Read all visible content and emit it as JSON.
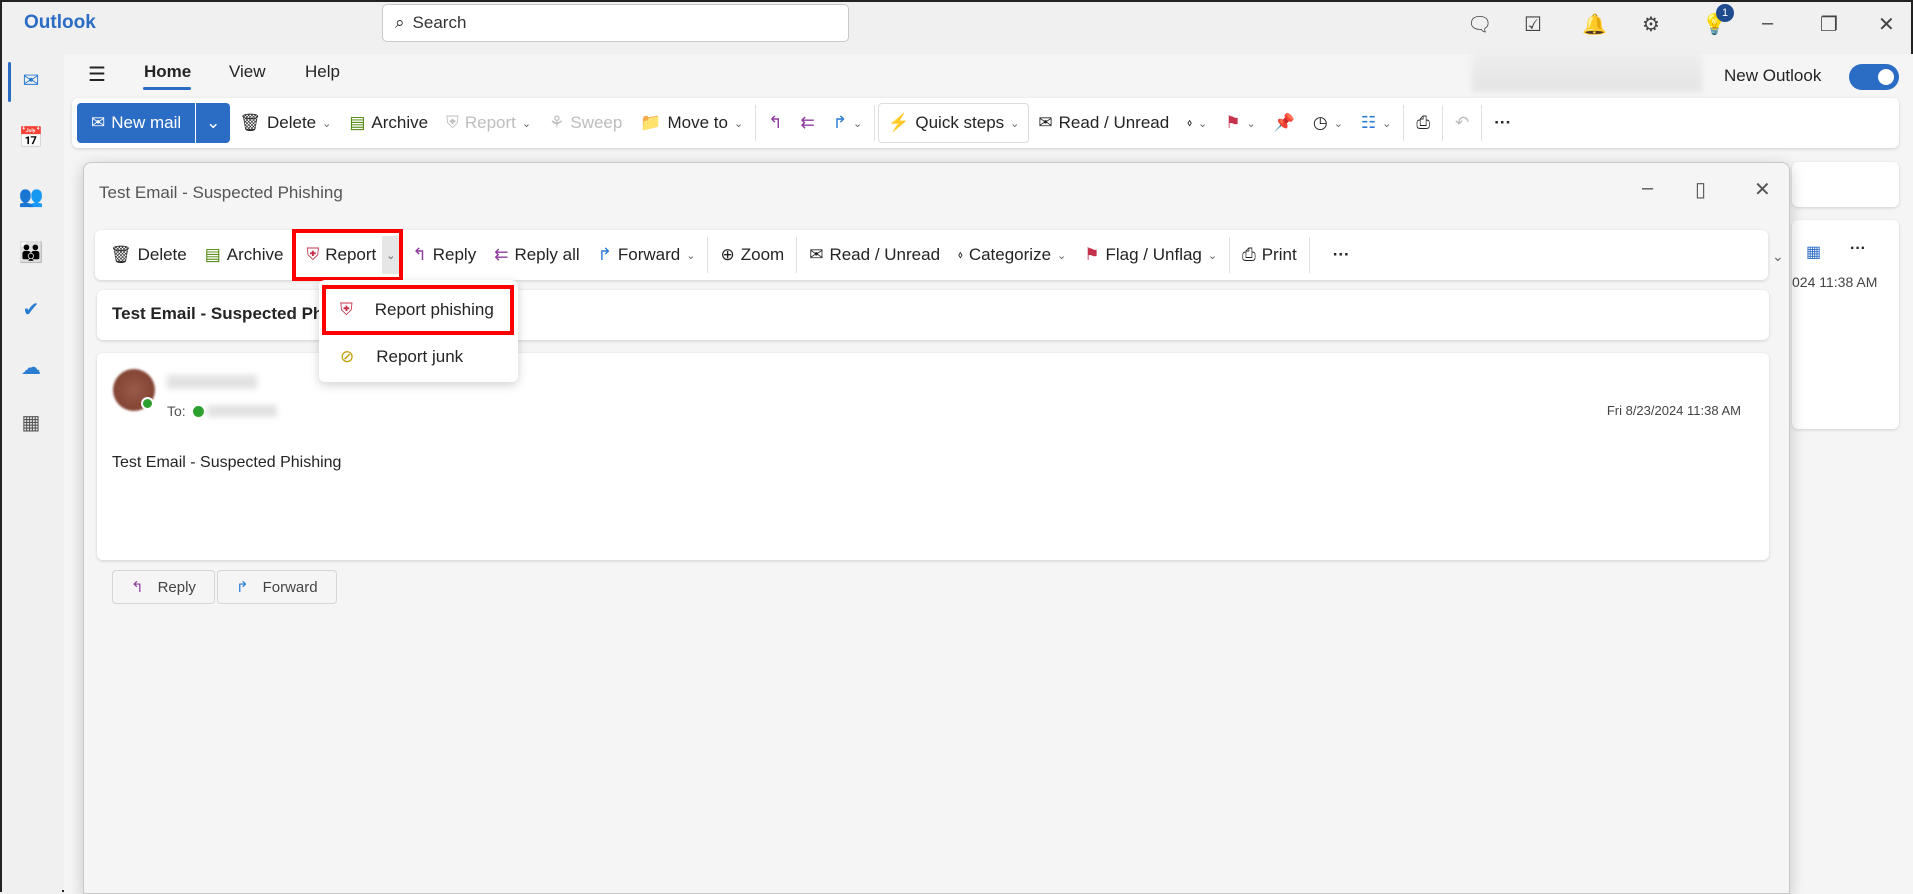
{
  "app": {
    "title": "Outlook",
    "search_placeholder": "Search",
    "notification_count": "1",
    "title_icons": [
      "feedback-icon",
      "tasks-icon",
      "bell-icon",
      "gear-icon",
      "lightbulb-icon"
    ]
  },
  "ribbon": {
    "tabs": [
      "Home",
      "View",
      "Help"
    ],
    "active_tab": "Home",
    "new_outlook_label": "New Outlook",
    "new_outlook_on": true,
    "buttons": {
      "new_mail": "New mail",
      "delete": "Delete",
      "archive": "Archive",
      "report": "Report",
      "sweep": "Sweep",
      "move_to": "Move to",
      "quick_steps": "Quick steps",
      "read_unread": "Read / Unread",
      "more": "···"
    }
  },
  "popup": {
    "title": "Test Email - Suspected Phishing",
    "toolbar": {
      "delete": "Delete",
      "archive": "Archive",
      "report": "Report",
      "reply": "Reply",
      "reply_all": "Reply all",
      "forward": "Forward",
      "zoom": "Zoom",
      "read_unread": "Read / Unread",
      "categorize": "Categorize",
      "flag": "Flag / Unflag",
      "print": "Print",
      "more": "···"
    },
    "report_menu": [
      {
        "label": "Report phishing",
        "icon": "shield-alert-icon"
      },
      {
        "label": "Report junk",
        "icon": "block-icon"
      }
    ],
    "subject": "Test Email - Suspected Phis",
    "message": {
      "to_label": "To:",
      "date": "Fri 8/23/2024 11:38 AM",
      "body": "Test Email - Suspected Phishing",
      "reply": "Reply",
      "forward": "Forward"
    }
  },
  "background": {
    "partial_date": "024 11:38 AM"
  },
  "colors": {
    "accent": "#2b6cc4",
    "highlight": "#ff0000"
  }
}
